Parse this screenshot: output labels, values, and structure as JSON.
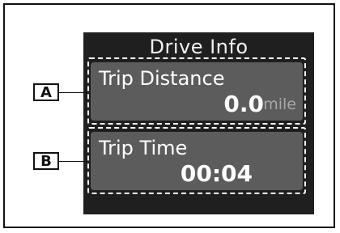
{
  "screen": {
    "title": "Drive Info"
  },
  "items": [
    {
      "tag": "A",
      "label": "Trip Distance",
      "value": "0.0",
      "unit": "mile"
    },
    {
      "tag": "B",
      "label": "Trip Time",
      "value": "00:04"
    }
  ],
  "colors": {
    "screen_background": "#1f1f1f",
    "card_background": "#5c5c5c",
    "unit_text": "#a8a8a8"
  }
}
